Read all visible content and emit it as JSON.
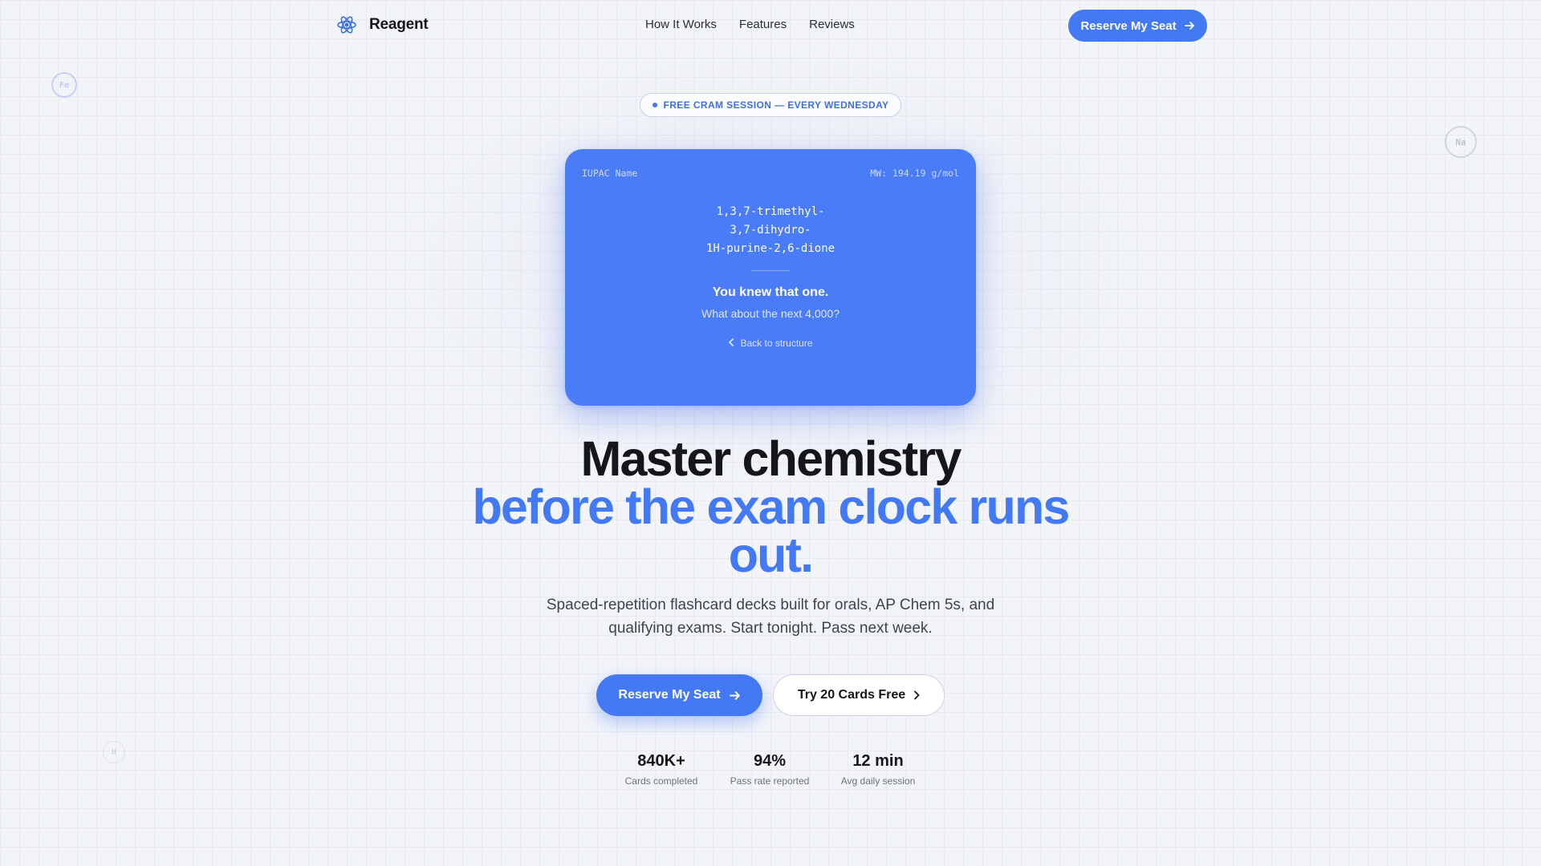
{
  "brand": {
    "name": "Reagent",
    "logo_icon": "atom-icon"
  },
  "nav": {
    "links": [
      "How It Works",
      "Features",
      "Reviews"
    ],
    "cta_label": "Reserve My Seat"
  },
  "floating_elements": [
    "Fe",
    "Na",
    "H"
  ],
  "announcement": {
    "text": "FREE CRAM SESSION — EVERY WEDNESDAY"
  },
  "card": {
    "label": "IUPAC Name",
    "molecular_weight": "MW: 194.19 g/mol",
    "formula_lines": [
      "1,3,7-trimethyl-",
      "3,7-dihydro-",
      "1H-purine-2,6-dione"
    ],
    "heading": "You knew that one.",
    "subtext": "What about the next 4,000?",
    "back_label": "Back to structure"
  },
  "hero": {
    "title_line1": "Master chemistry",
    "title_line2": "before the exam clock runs out.",
    "lede": "Spaced-repetition flashcard decks built for orals, AP Chem 5s, and qualifying exams. Start tonight. Pass next week.",
    "primary_cta": "Reserve My Seat",
    "secondary_cta": "Try 20 Cards Free"
  },
  "stats": [
    {
      "value": "840K+",
      "label": "Cards completed"
    },
    {
      "value": "94%",
      "label": "Pass rate reported"
    },
    {
      "value": "12 min",
      "label": "Avg daily session"
    }
  ],
  "colors": {
    "accent": "#4479f5",
    "card": "#497cf6",
    "text": "#14161c",
    "background": "#f2f4f8"
  }
}
